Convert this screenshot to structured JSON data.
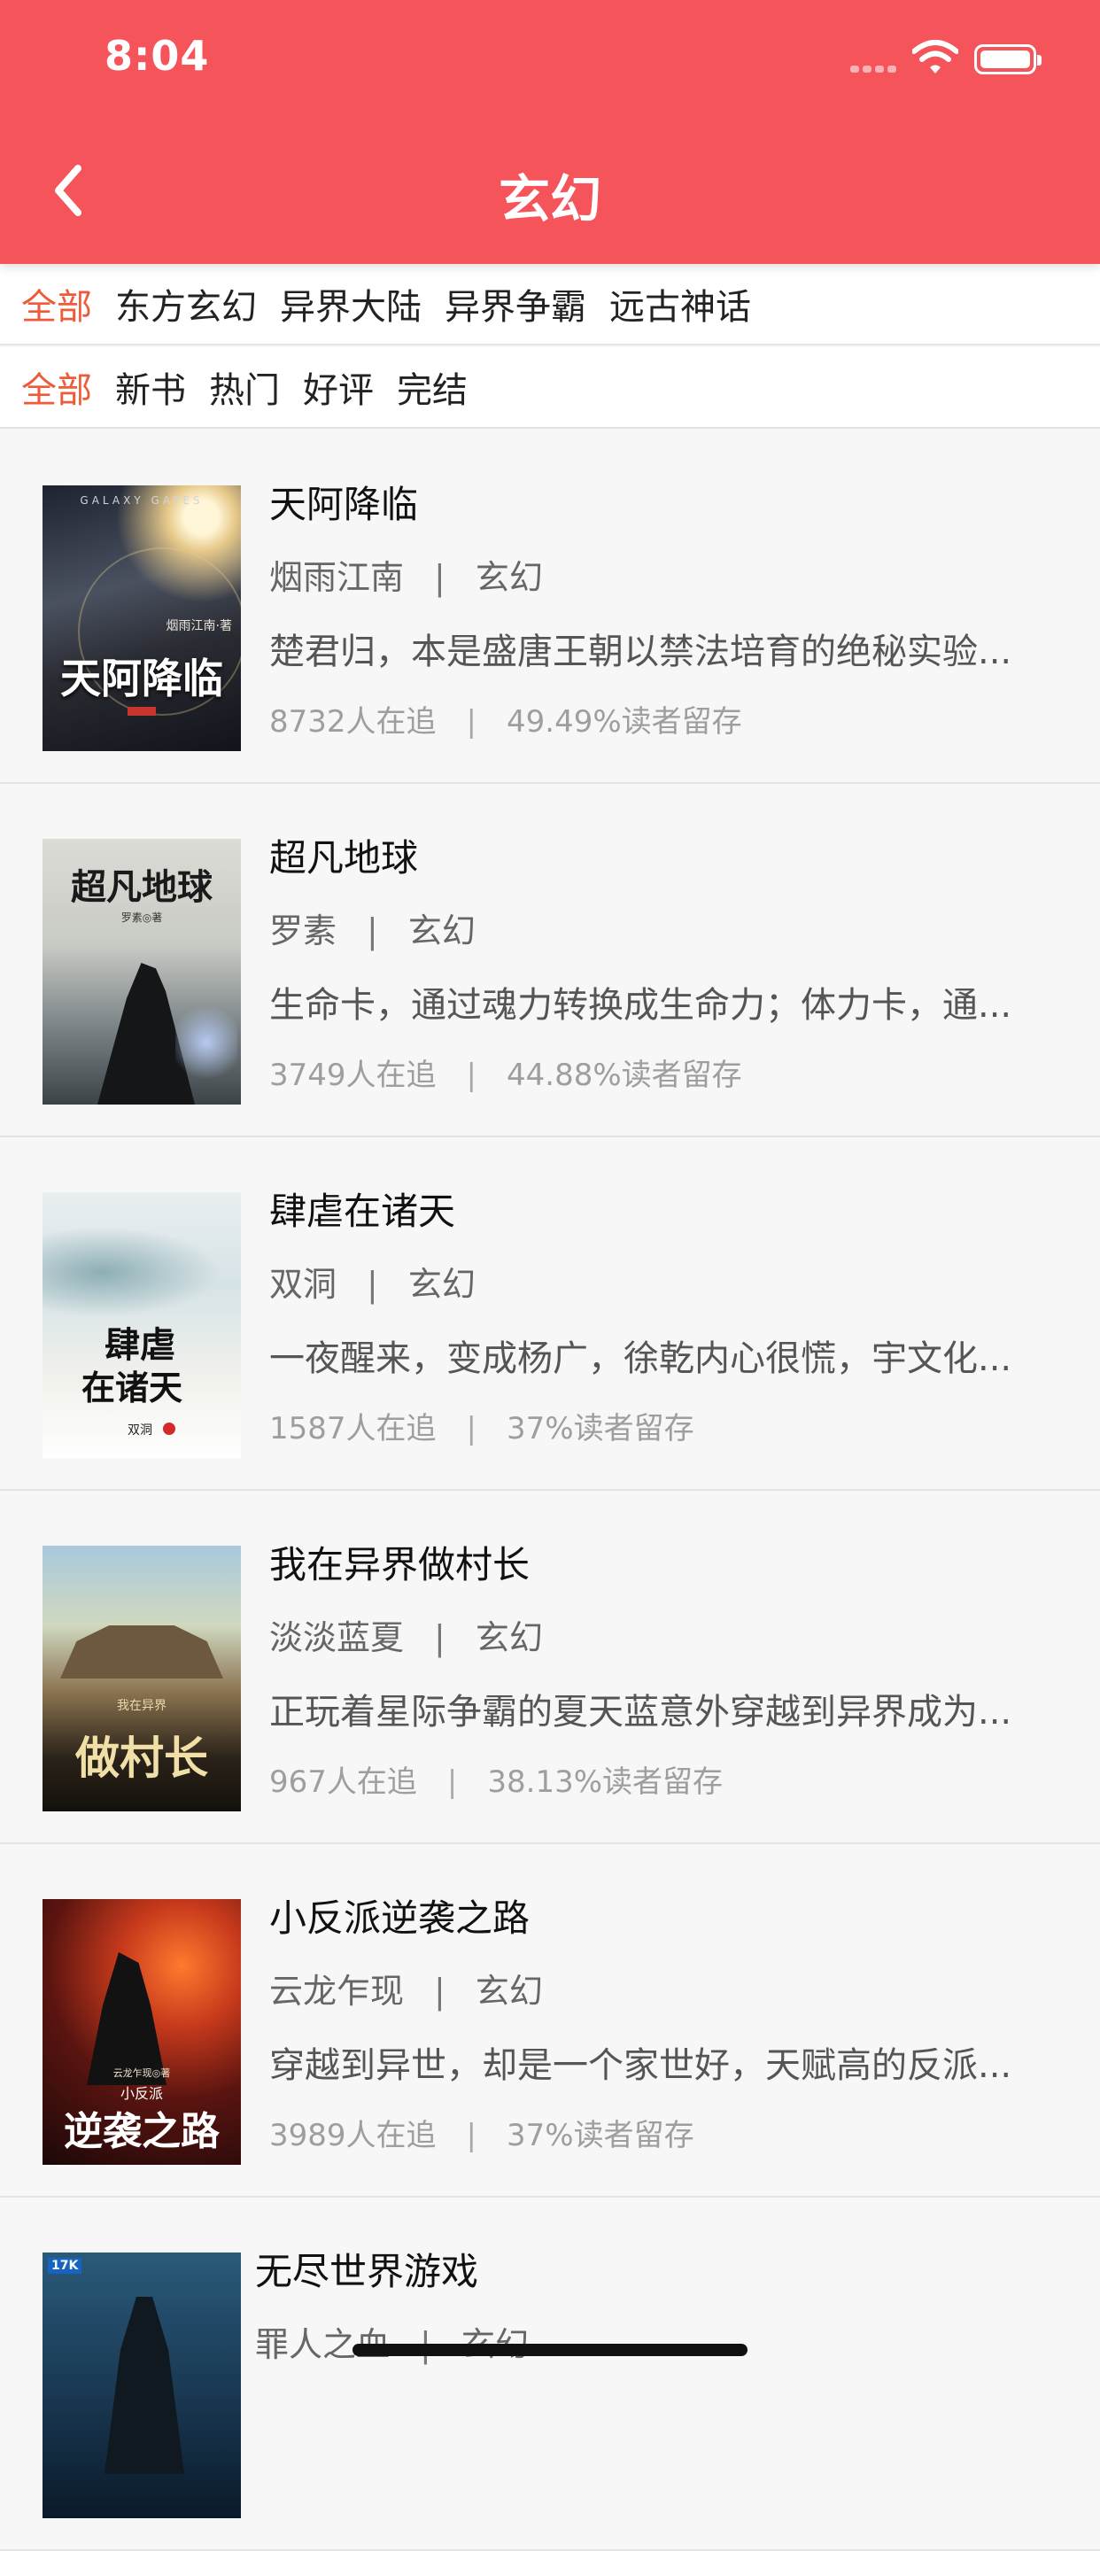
{
  "status_bar": {
    "time": "8:04"
  },
  "header": {
    "title": "玄幻",
    "back_icon": "chevron-left-icon",
    "background_color": "#f4545a"
  },
  "filters": {
    "categories": [
      {
        "label": "全部",
        "active": true
      },
      {
        "label": "东方玄幻",
        "active": false
      },
      {
        "label": "异界大陆",
        "active": false
      },
      {
        "label": "异界争霸",
        "active": false
      },
      {
        "label": "远古神话",
        "active": false
      }
    ],
    "sorts": [
      {
        "label": "全部",
        "active": true
      },
      {
        "label": "新书",
        "active": false
      },
      {
        "label": "热门",
        "active": false
      },
      {
        "label": "好评",
        "active": false
      },
      {
        "label": "完结",
        "active": false
      }
    ],
    "active_color": "#ee5a3a"
  },
  "books": [
    {
      "title": "天阿降临",
      "author": "烟雨江南",
      "separator": "|",
      "genre": "玄幻",
      "description": "楚君归，本是盛唐王朝以禁法培育的绝秘实验...",
      "followers": "8732人在追",
      "retention": "49.49%读者留存",
      "cover_title": "天阿降临",
      "cover_top": "GALAXY GATES",
      "cover_author": "烟雨江南·著"
    },
    {
      "title": "超凡地球",
      "author": "罗素",
      "separator": "|",
      "genre": "玄幻",
      "description": "生命卡，通过魂力转换成生命力；体力卡，通...",
      "followers": "3749人在追",
      "retention": "44.88%读者留存",
      "cover_title": "超凡地球",
      "cover_author": "罗素◎著"
    },
    {
      "title": "肆虐在诸天",
      "author": "双洞",
      "separator": "|",
      "genre": "玄幻",
      "description": "一夜醒来，变成杨广，徐乾内心很慌，宇文化...",
      "followers": "1587人在追",
      "retention": "37%读者留存",
      "cover_title_line1": "肆虐",
      "cover_title_line2": "在诸天",
      "cover_author": "双洞"
    },
    {
      "title": "我在异界做村长",
      "author": "淡淡蓝夏",
      "separator": "|",
      "genre": "玄幻",
      "description": "正玩着星际争霸的夏天蓝意外穿越到异界成为...",
      "followers": "967人在追",
      "retention": "38.13%读者留存",
      "cover_title": "做村长",
      "cover_subtitle": "我在异界"
    },
    {
      "title": "小反派逆袭之路",
      "author": "云龙乍现",
      "separator": "|",
      "genre": "玄幻",
      "description": "穿越到异世，却是一个家世好，天赋高的反派...",
      "followers": "3989人在追",
      "retention": "37%读者留存",
      "cover_title": "逆袭之路",
      "cover_subtitle": "小反派",
      "cover_author": "云龙乍现◎著"
    },
    {
      "title": "无尽世界游戏",
      "author": "罪人之血",
      "separator": "|",
      "genre": "玄幻",
      "cover_badge": "17K"
    }
  ]
}
